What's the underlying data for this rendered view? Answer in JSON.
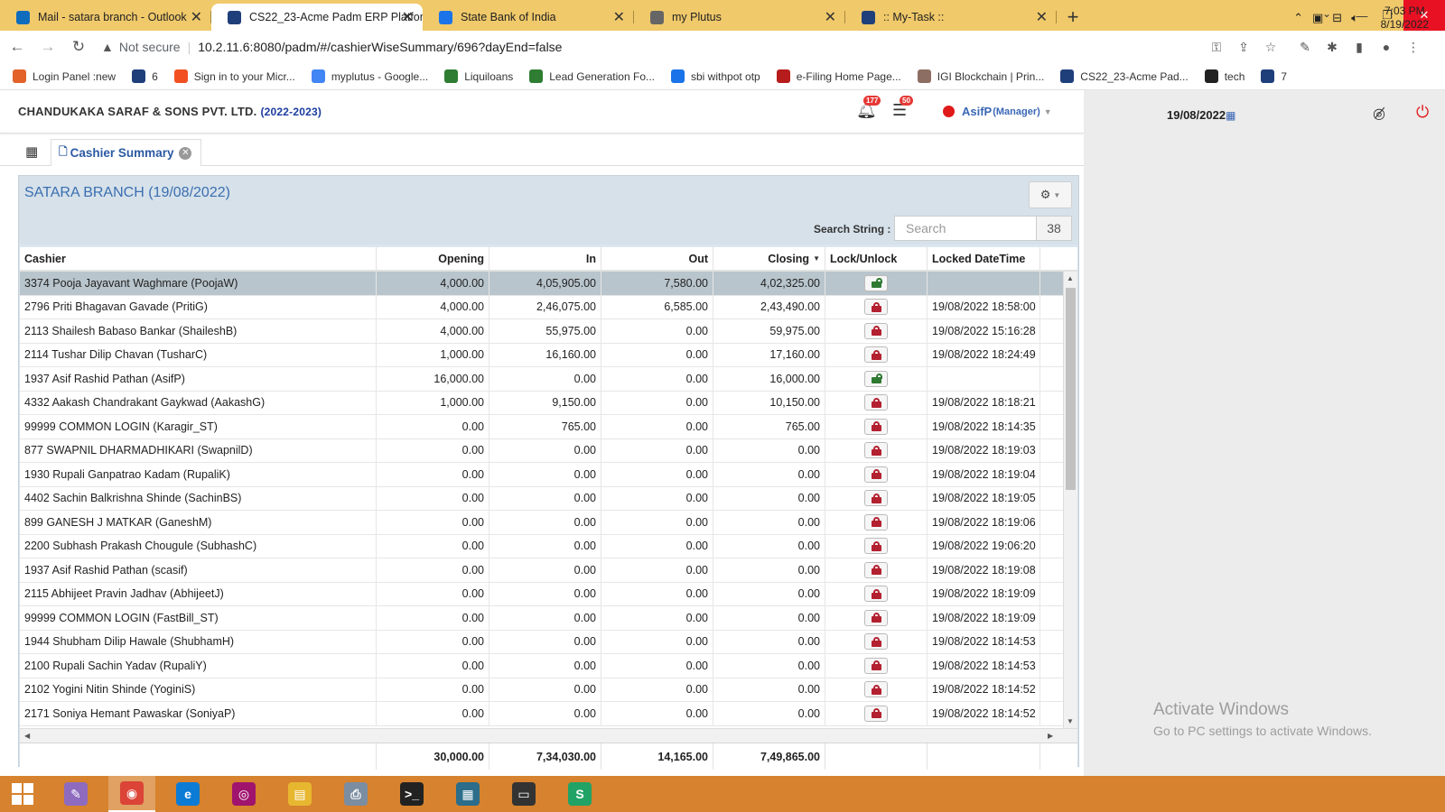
{
  "browser": {
    "tabs": [
      {
        "title": "Mail - satara branch - Outlook",
        "icon": "outlook-icon",
        "color": "#0f6cbd",
        "active": false
      },
      {
        "title": "CS22_23-Acme Padm ERP Platfor",
        "icon": "acme-erp-icon",
        "color": "#1f3f7a",
        "active": true
      },
      {
        "title": "State Bank of India",
        "icon": "sbi-icon",
        "color": "#1a73e8",
        "active": false
      },
      {
        "title": "my Plutus",
        "icon": "globe-icon",
        "color": "#666666",
        "active": false
      },
      {
        "title": ":: My-Task ::",
        "icon": "mytask-icon",
        "color": "#1f3f7a",
        "active": false
      }
    ],
    "not_secure": "Not secure",
    "url": "10.2.11.6:8080/padm/#/cashierWiseSummary/696?dayEnd=false",
    "bookmarks": [
      {
        "label": "Login Panel :new",
        "color": "#e2622a"
      },
      {
        "label": "6",
        "color": "#1f3f7a"
      },
      {
        "label": "Sign in to your Micr...",
        "color": "#f25022"
      },
      {
        "label": "myplutus - Google...",
        "color": "#4285f4"
      },
      {
        "label": "Liquiloans",
        "color": "#2e7d32"
      },
      {
        "label": "Lead Generation Fo...",
        "color": "#2e7d32"
      },
      {
        "label": "sbi withpot otp",
        "color": "#1a73e8"
      },
      {
        "label": "e-Filing Home Page...",
        "color": "#b71c1c"
      },
      {
        "label": "IGI Blockchain | Prin...",
        "color": "#8d6e63"
      },
      {
        "label": "CS22_23-Acme Pad...",
        "color": "#1f3f7a"
      },
      {
        "label": "tech",
        "color": "#222222"
      },
      {
        "label": "7",
        "color": "#1f3f7a"
      }
    ]
  },
  "header": {
    "company": "CHANDUKAKA SARAF & SONS PVT. LTD.",
    "year": "(2022-2023)",
    "notifications_count": "177",
    "messages_count": "50",
    "user": "AsifP",
    "role": "(Manager)",
    "date": "19/08/2022"
  },
  "page_tab": {
    "label": "Cashier Summary"
  },
  "panel": {
    "title": "SATARA BRANCH (19/08/2022)",
    "search_label": "Search String :",
    "search_placeholder": "Search",
    "count": "38"
  },
  "table": {
    "columns": [
      "Cashier",
      "Opening",
      "In",
      "Out",
      "Closing",
      "Lock/Unlock",
      "Locked DateTime"
    ],
    "rows": [
      {
        "cashier": "3374 Pooja Jayavant Waghmare (PoojaW)",
        "opening": "4,000.00",
        "in": "4,05,905.00",
        "out": "7,580.00",
        "closing": "4,02,325.00",
        "locked": false,
        "locked_at": ""
      },
      {
        "cashier": "2796 Priti Bhagavan Gavade (PritiG)",
        "opening": "4,000.00",
        "in": "2,46,075.00",
        "out": "6,585.00",
        "closing": "2,43,490.00",
        "locked": true,
        "locked_at": "19/08/2022 18:58:00"
      },
      {
        "cashier": "2113 Shailesh Babaso Bankar (ShaileshB)",
        "opening": "4,000.00",
        "in": "55,975.00",
        "out": "0.00",
        "closing": "59,975.00",
        "locked": true,
        "locked_at": "19/08/2022 15:16:28"
      },
      {
        "cashier": "2114 Tushar Dilip Chavan (TusharC)",
        "opening": "1,000.00",
        "in": "16,160.00",
        "out": "0.00",
        "closing": "17,160.00",
        "locked": true,
        "locked_at": "19/08/2022 18:24:49"
      },
      {
        "cashier": "1937 Asif Rashid Pathan (AsifP)",
        "opening": "16,000.00",
        "in": "0.00",
        "out": "0.00",
        "closing": "16,000.00",
        "locked": false,
        "locked_at": ""
      },
      {
        "cashier": "4332 Aakash Chandrakant Gaykwad (AakashG)",
        "opening": "1,000.00",
        "in": "9,150.00",
        "out": "0.00",
        "closing": "10,150.00",
        "locked": true,
        "locked_at": "19/08/2022 18:18:21"
      },
      {
        "cashier": "99999 COMMON LOGIN (Karagir_ST)",
        "opening": "0.00",
        "in": "765.00",
        "out": "0.00",
        "closing": "765.00",
        "locked": true,
        "locked_at": "19/08/2022 18:14:35"
      },
      {
        "cashier": "877 SWAPNIL DHARMADHIKARI (SwapnilD)",
        "opening": "0.00",
        "in": "0.00",
        "out": "0.00",
        "closing": "0.00",
        "locked": true,
        "locked_at": "19/08/2022 18:19:03"
      },
      {
        "cashier": "1930 Rupali Ganpatrao Kadam (RupaliK)",
        "opening": "0.00",
        "in": "0.00",
        "out": "0.00",
        "closing": "0.00",
        "locked": true,
        "locked_at": "19/08/2022 18:19:04"
      },
      {
        "cashier": "4402 Sachin Balkrishna Shinde (SachinBS)",
        "opening": "0.00",
        "in": "0.00",
        "out": "0.00",
        "closing": "0.00",
        "locked": true,
        "locked_at": "19/08/2022 18:19:05"
      },
      {
        "cashier": "899 GANESH J MATKAR (GaneshM)",
        "opening": "0.00",
        "in": "0.00",
        "out": "0.00",
        "closing": "0.00",
        "locked": true,
        "locked_at": "19/08/2022 18:19:06"
      },
      {
        "cashier": "2200 Subhash Prakash Chougule (SubhashC)",
        "opening": "0.00",
        "in": "0.00",
        "out": "0.00",
        "closing": "0.00",
        "locked": true,
        "locked_at": "19/08/2022 19:06:20"
      },
      {
        "cashier": "1937 Asif Rashid Pathan (scasif)",
        "opening": "0.00",
        "in": "0.00",
        "out": "0.00",
        "closing": "0.00",
        "locked": true,
        "locked_at": "19/08/2022 18:19:08"
      },
      {
        "cashier": "2115 Abhijeet Pravin Jadhav (AbhijeetJ)",
        "opening": "0.00",
        "in": "0.00",
        "out": "0.00",
        "closing": "0.00",
        "locked": true,
        "locked_at": "19/08/2022 18:19:09"
      },
      {
        "cashier": "99999 COMMON LOGIN (FastBill_ST)",
        "opening": "0.00",
        "in": "0.00",
        "out": "0.00",
        "closing": "0.00",
        "locked": true,
        "locked_at": "19/08/2022 18:19:09"
      },
      {
        "cashier": "1944 Shubham Dilip Hawale (ShubhamH)",
        "opening": "0.00",
        "in": "0.00",
        "out": "0.00",
        "closing": "0.00",
        "locked": true,
        "locked_at": "19/08/2022 18:14:53"
      },
      {
        "cashier": "2100 Rupali Sachin Yadav (RupaliY)",
        "opening": "0.00",
        "in": "0.00",
        "out": "0.00",
        "closing": "0.00",
        "locked": true,
        "locked_at": "19/08/2022 18:14:53"
      },
      {
        "cashier": "2102 Yogini Nitin Shinde (YoginiS)",
        "opening": "0.00",
        "in": "0.00",
        "out": "0.00",
        "closing": "0.00",
        "locked": true,
        "locked_at": "19/08/2022 18:14:52"
      },
      {
        "cashier": "2171 Soniya Hemant Pawaskar (SoniyaP)",
        "opening": "0.00",
        "in": "0.00",
        "out": "0.00",
        "closing": "0.00",
        "locked": true,
        "locked_at": "19/08/2022 18:14:52"
      }
    ],
    "totals": {
      "opening": "30,000.00",
      "in": "7,34,030.00",
      "out": "14,165.00",
      "closing": "7,49,865.00"
    }
  },
  "watermark": {
    "line1": "Activate Windows",
    "line2": "Go to PC settings to activate Windows."
  },
  "taskbar": {
    "apps": [
      {
        "name": "paint-icon",
        "color": "#8e6bbf",
        "glyph": "✎"
      },
      {
        "name": "chrome-icon",
        "color": "#db4437",
        "glyph": "◉"
      },
      {
        "name": "edge-icon",
        "color": "#0c7bd5",
        "glyph": "e"
      },
      {
        "name": "camera-icon",
        "color": "#a0146e",
        "glyph": "◎"
      },
      {
        "name": "file-explorer-icon",
        "color": "#e8b730",
        "glyph": "▤"
      },
      {
        "name": "fax-icon",
        "color": "#7b8da0",
        "glyph": "⎙"
      },
      {
        "name": "terminal-icon",
        "color": "#222222",
        "glyph": ">_"
      },
      {
        "name": "notes-icon",
        "color": "#2b6d8a",
        "glyph": "▦"
      },
      {
        "name": "window-icon",
        "color": "#333333",
        "glyph": "▭"
      },
      {
        "name": "sheets-icon",
        "color": "#21a366",
        "glyph": "S"
      }
    ],
    "time": "7:03 PM",
    "date": "8/19/2022"
  }
}
